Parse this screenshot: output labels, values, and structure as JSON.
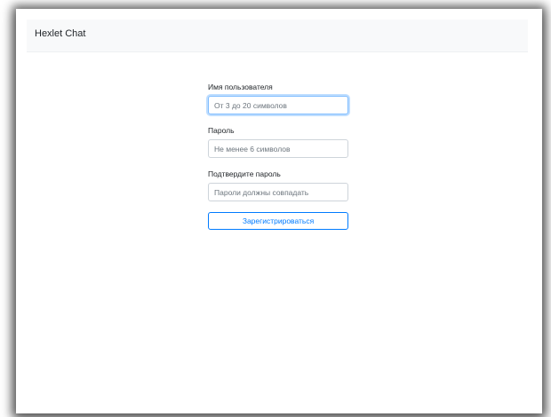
{
  "navbar": {
    "brand": "Hexlet Chat"
  },
  "signup_form": {
    "username": {
      "label": "Имя пользователя",
      "placeholder": "От 3 до 20 символов",
      "value": ""
    },
    "password": {
      "label": "Пароль",
      "placeholder": "Не менее 6 символов",
      "value": ""
    },
    "confirm_password": {
      "label": "Подтвердите пароль",
      "placeholder": "Пароли должны совпадать",
      "value": ""
    },
    "submit_label": "Зарегистрироваться"
  },
  "colors": {
    "primary": "#007bff",
    "navbar_bg": "#f8f9fa",
    "focus_border": "#80bdff"
  }
}
